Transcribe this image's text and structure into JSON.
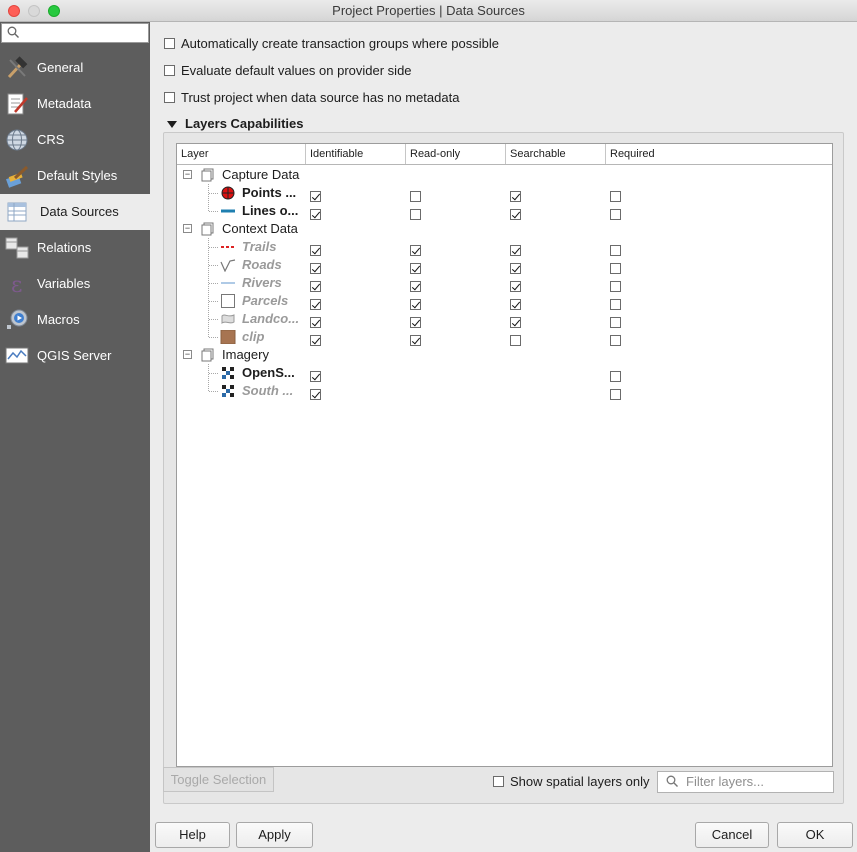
{
  "window": {
    "title": "Project Properties | Data Sources"
  },
  "sidebar": {
    "search_placeholder": "",
    "items": [
      {
        "label": "General",
        "icon": "hammer-icon"
      },
      {
        "label": "Metadata",
        "icon": "metadata-icon"
      },
      {
        "label": "CRS",
        "icon": "globe-icon"
      },
      {
        "label": "Default Styles",
        "icon": "brush-icon"
      },
      {
        "label": "Data Sources",
        "icon": "table-icon",
        "active": true
      },
      {
        "label": "Relations",
        "icon": "relations-icon"
      },
      {
        "label": "Variables",
        "icon": "epsilon-icon"
      },
      {
        "label": "Macros",
        "icon": "gear-play-icon"
      },
      {
        "label": "QGIS Server",
        "icon": "server-map-icon"
      }
    ]
  },
  "options": {
    "transaction_groups": {
      "label": "Automatically create transaction groups where possible",
      "checked": false
    },
    "evaluate_defaults": {
      "label": "Evaluate default values on provider side",
      "checked": false
    },
    "trust_project": {
      "label": "Trust project when data source has no metadata",
      "checked": false
    }
  },
  "layers_group": {
    "title": "Layers Capabilities",
    "columns": [
      "Layer",
      "Identifiable",
      "Read-only",
      "Searchable",
      "Required"
    ],
    "groups": [
      {
        "name": "Capture Data",
        "layers": [
          {
            "name": "Points ...",
            "icon": "point-marker-icon",
            "identifiable": true,
            "readonly": false,
            "searchable": true,
            "required": false,
            "muted": false
          },
          {
            "name": "Lines o...",
            "icon": "line-blue-icon",
            "identifiable": true,
            "readonly": false,
            "searchable": true,
            "required": false,
            "muted": false
          }
        ]
      },
      {
        "name": "Context Data",
        "layers": [
          {
            "name": "Trails",
            "icon": "dashed-red-line-icon",
            "identifiable": true,
            "readonly": true,
            "searchable": true,
            "required": false,
            "muted": true
          },
          {
            "name": "Roads",
            "icon": "road-line-icon",
            "identifiable": true,
            "readonly": true,
            "searchable": true,
            "required": false,
            "muted": true
          },
          {
            "name": "Rivers",
            "icon": "river-line-icon",
            "identifiable": true,
            "readonly": true,
            "searchable": true,
            "required": false,
            "muted": true
          },
          {
            "name": "Parcels",
            "icon": "polygon-outline-icon",
            "identifiable": true,
            "readonly": true,
            "searchable": true,
            "required": false,
            "muted": true
          },
          {
            "name": "Landco...",
            "icon": "landcover-shape-icon",
            "identifiable": true,
            "readonly": true,
            "searchable": true,
            "required": false,
            "muted": true
          },
          {
            "name": "clip",
            "icon": "brown-fill-icon",
            "identifiable": true,
            "readonly": true,
            "searchable": false,
            "required": false,
            "muted": true
          }
        ]
      },
      {
        "name": "Imagery",
        "layers": [
          {
            "name": "OpenS...",
            "icon": "raster-icon",
            "identifiable": true,
            "readonly": null,
            "searchable": null,
            "required": false,
            "muted": false
          },
          {
            "name": "South ...",
            "icon": "raster-icon",
            "identifiable": true,
            "readonly": null,
            "searchable": null,
            "required": false,
            "muted": true
          }
        ]
      }
    ],
    "toggle_selection_label": "Toggle Selection",
    "spatial_only": {
      "label": "Show spatial layers only",
      "checked": false
    },
    "filter_placeholder": "Filter layers..."
  },
  "buttons": {
    "help": "Help",
    "apply": "Apply",
    "cancel": "Cancel",
    "ok": "OK"
  }
}
